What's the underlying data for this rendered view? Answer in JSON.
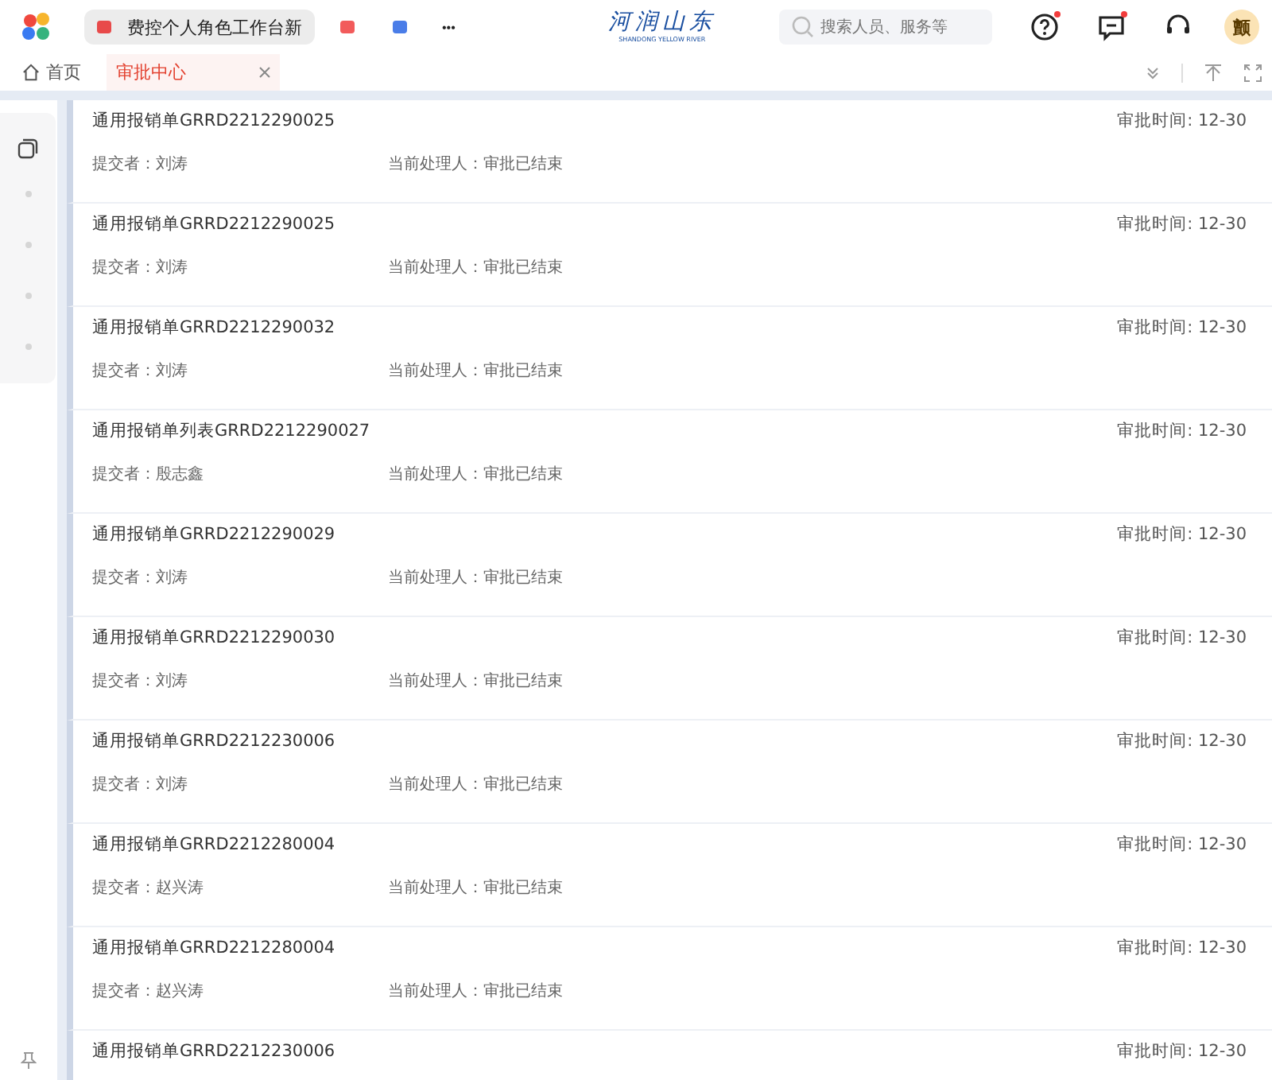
{
  "top_bar": {
    "app_tabs": [
      {
        "label": "费控个人角色工作台新",
        "selected": true
      },
      {
        "selected": false
      },
      {
        "selected": false
      }
    ],
    "more": "•••",
    "logo": {
      "title": "河润山东",
      "subtitle": "SHANDONG YELLOW RIVER"
    },
    "search": {
      "placeholder": "搜索人员、服务等"
    },
    "icons": [
      {
        "kind": "help",
        "badge": true
      },
      {
        "kind": "message",
        "badge": true
      },
      {
        "kind": "support",
        "badge": false
      }
    ],
    "avatar": "颤"
  },
  "page_tabs": [
    {
      "label": "首页",
      "kind": "home",
      "selected": false
    },
    {
      "label": "审批中心",
      "kind": "closable",
      "selected": true
    }
  ],
  "items": [
    {
      "title": "通用报销单GRRD2212290025",
      "time": "审批时间: 12-30",
      "submitter": "提交者：刘涛",
      "handler": "当前处理人：审批已结束"
    },
    {
      "title": "通用报销单GRRD2212290025",
      "time": "审批时间: 12-30",
      "submitter": "提交者：刘涛",
      "handler": "当前处理人：审批已结束"
    },
    {
      "title": "通用报销单GRRD2212290032",
      "time": "审批时间: 12-30",
      "submitter": "提交者：刘涛",
      "handler": "当前处理人：审批已结束"
    },
    {
      "title": "通用报销单列表GRRD2212290027",
      "time": "审批时间: 12-30",
      "submitter": "提交者：殷志鑫",
      "handler": "当前处理人：审批已结束"
    },
    {
      "title": "通用报销单GRRD2212290029",
      "time": "审批时间: 12-30",
      "submitter": "提交者：刘涛",
      "handler": "当前处理人：审批已结束"
    },
    {
      "title": "通用报销单GRRD2212290030",
      "time": "审批时间: 12-30",
      "submitter": "提交者：刘涛",
      "handler": "当前处理人：审批已结束"
    },
    {
      "title": "通用报销单GRRD2212230006",
      "time": "审批时间: 12-30",
      "submitter": "提交者：刘涛",
      "handler": "当前处理人：审批已结束"
    },
    {
      "title": "通用报销单GRRD2212280004",
      "time": "审批时间: 12-30",
      "submitter": "提交者：赵兴涛",
      "handler": "当前处理人：审批已结束"
    },
    {
      "title": "通用报销单GRRD2212280004",
      "time": "审批时间: 12-30",
      "submitter": "提交者：赵兴涛",
      "handler": "当前处理人：审批已结束"
    },
    {
      "title": "通用报销单GRRD2212230006",
      "time": "审批时间: 12-30"
    }
  ]
}
